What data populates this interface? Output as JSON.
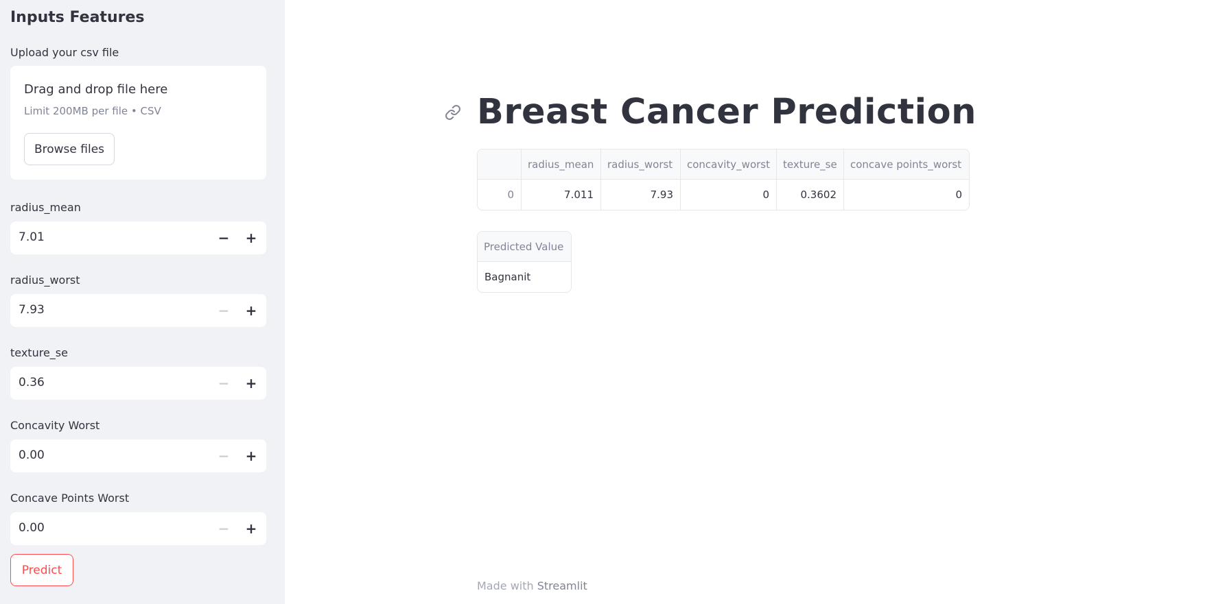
{
  "sidebar": {
    "title": "Inputs Features",
    "upload": {
      "label": "Upload your csv file",
      "drop_text": "Drag and drop file here",
      "limit_text": "Limit 200MB per file • CSV",
      "browse_label": "Browse files"
    },
    "inputs": [
      {
        "label": "radius_mean",
        "value": "7.01"
      },
      {
        "label": "radius_worst",
        "value": "7.93"
      },
      {
        "label": "texture_se",
        "value": "0.36"
      },
      {
        "label": "Concavity Worst",
        "value": "0.00"
      },
      {
        "label": "Concave Points Worst",
        "value": "0.00"
      }
    ],
    "predict_label": "Predict"
  },
  "main": {
    "title": "Breast Cancer Prediction",
    "table": {
      "columns": [
        "",
        "radius_mean",
        "radius_worst",
        "concavity_worst",
        "texture_se",
        "concave points_worst"
      ],
      "rows": [
        [
          "0",
          "7.011",
          "7.93",
          "0",
          "0.3602",
          "0"
        ]
      ]
    },
    "prediction": {
      "header": "Predicted Value",
      "value": "Bagnanit"
    }
  },
  "footer": {
    "prefix": "Made with ",
    "brand": "Streamlit"
  },
  "icons": {
    "link": "link-icon",
    "minus": "minus-icon",
    "plus": "plus-icon"
  },
  "colors": {
    "accent": "#ff4b4b",
    "sidebar_bg": "#f0f2f6",
    "text": "#31333f"
  }
}
